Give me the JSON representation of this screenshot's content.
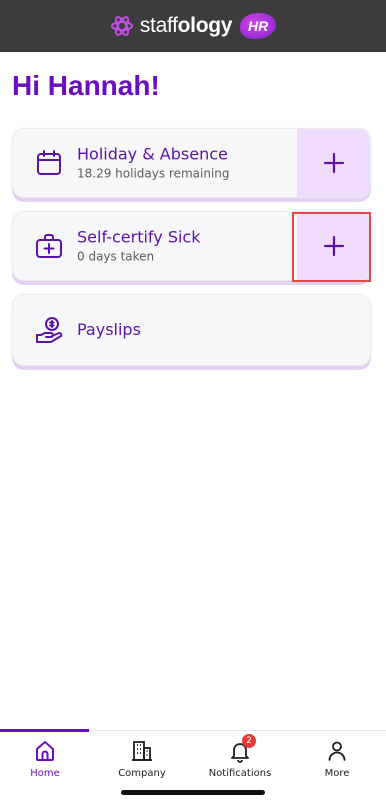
{
  "header": {
    "brand_prefix": "staff",
    "brand_bold": "ology",
    "brand_badge": "HR",
    "background": "#3c3c3c",
    "accent": "#9b2bd8"
  },
  "greeting": "Hi Hannah!",
  "cards": [
    {
      "title": "Holiday & Absence",
      "subtitle": "18.29 holidays remaining",
      "icon": "calendar-icon",
      "action": "+"
    },
    {
      "title": "Self-certify Sick",
      "subtitle": "0 days taken",
      "icon": "medical-kit-icon",
      "action": "+"
    },
    {
      "title": "Payslips",
      "icon": "payslip-hand-icon"
    }
  ],
  "nav": {
    "items": [
      {
        "label": "Home",
        "icon": "home-icon",
        "active": true
      },
      {
        "label": "Company",
        "icon": "building-icon"
      },
      {
        "label": "Notifications",
        "icon": "bell-icon",
        "badge": "2"
      },
      {
        "label": "More",
        "icon": "person-icon"
      }
    ]
  },
  "colors": {
    "primary": "#6a0fbf",
    "card_action_bg": "#efdcfb",
    "badge": "#e53935"
  }
}
